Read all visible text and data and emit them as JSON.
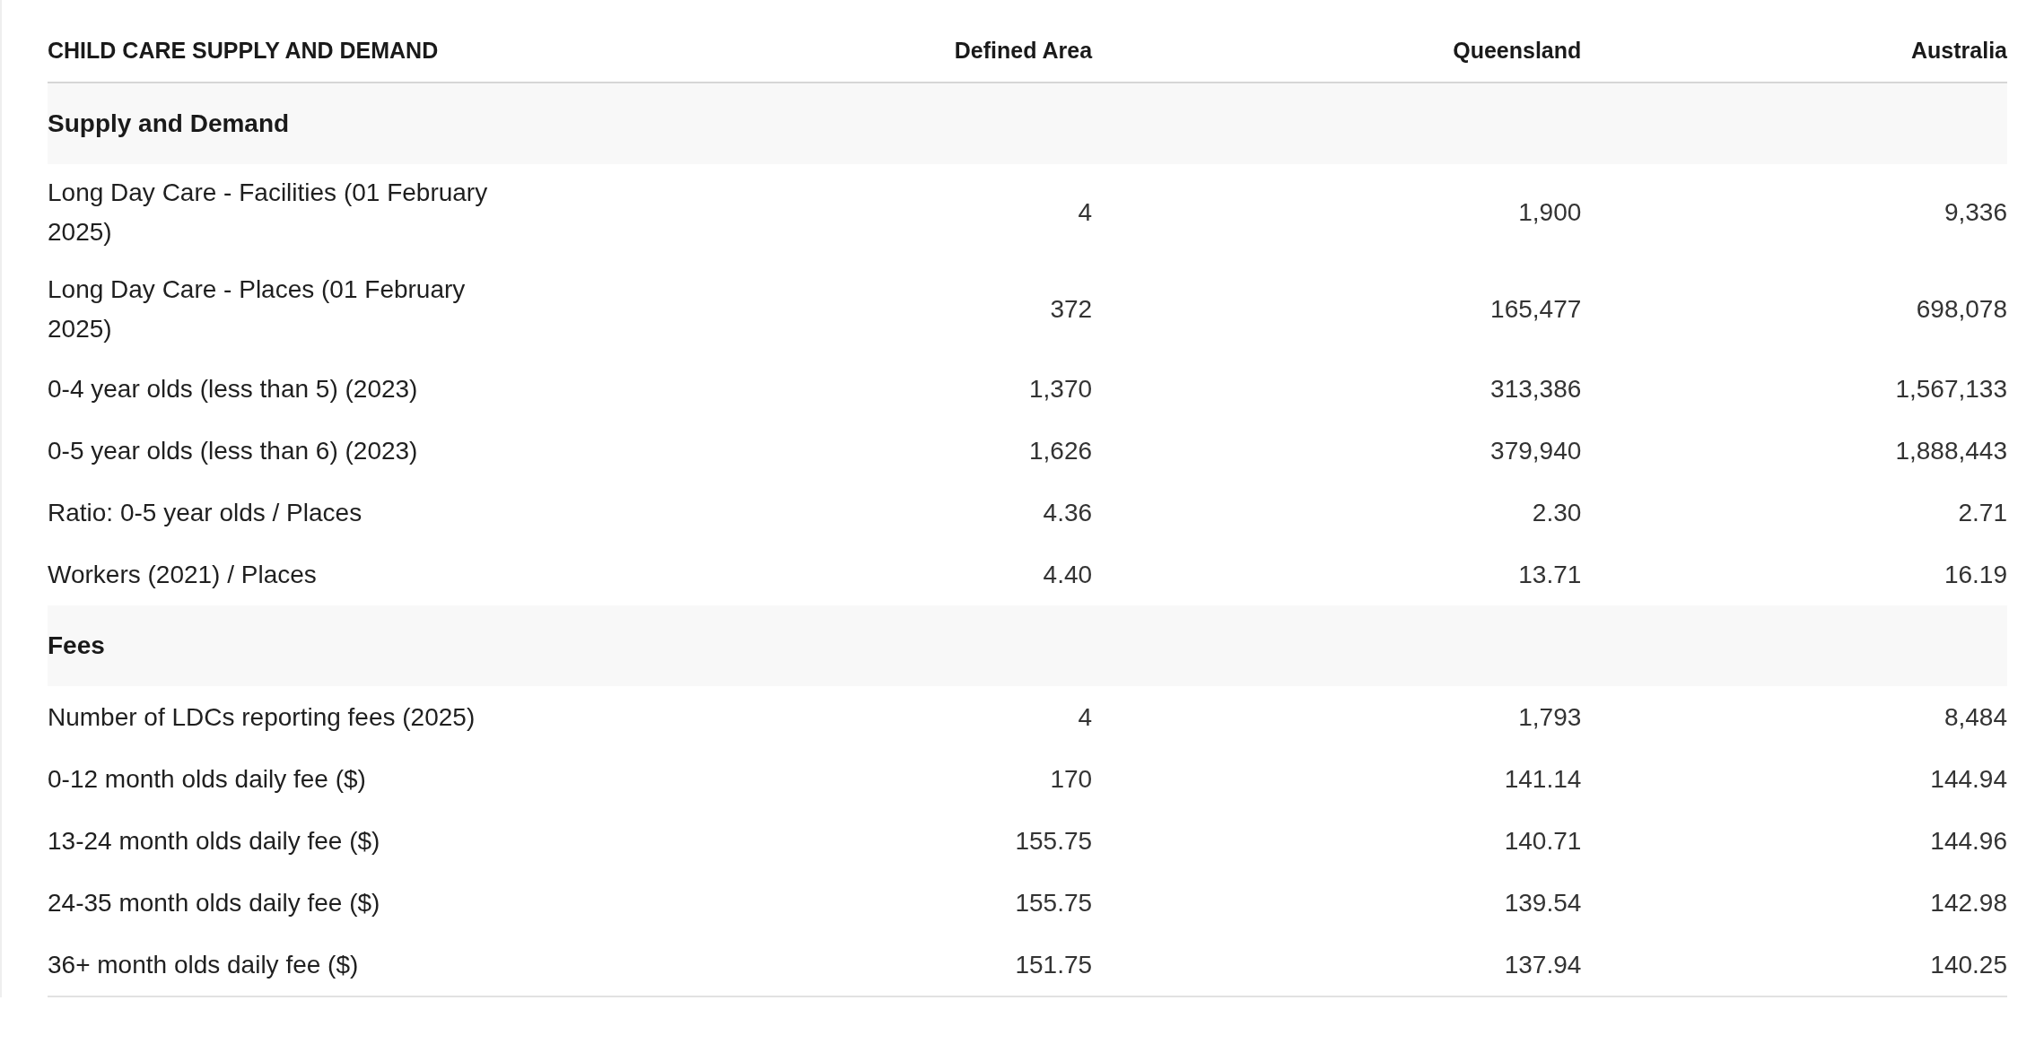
{
  "table": {
    "columns": [
      "CHILD CARE SUPPLY AND DEMAND",
      "Defined Area",
      "Queensland",
      "Australia"
    ],
    "sections": [
      {
        "title": "Supply and Demand",
        "rows": [
          {
            "label": "Long Day Care - Facilities (01 February 2025)",
            "values": [
              "4",
              "1,900",
              "9,336"
            ]
          },
          {
            "label": "Long Day Care - Places (01 February 2025)",
            "values": [
              "372",
              "165,477",
              "698,078"
            ]
          },
          {
            "label": "0-4 year olds (less than 5) (2023)",
            "values": [
              "1,370",
              "313,386",
              "1,567,133"
            ]
          },
          {
            "label": "0-5 year olds (less than 6) (2023)",
            "values": [
              "1,626",
              "379,940",
              "1,888,443"
            ]
          },
          {
            "label": "Ratio: 0-5 year olds / Places",
            "values": [
              "4.36",
              "2.30",
              "2.71"
            ]
          },
          {
            "label": "Workers (2021) / Places",
            "values": [
              "4.40",
              "13.71",
              "16.19"
            ]
          }
        ]
      },
      {
        "title": "Fees",
        "rows": [
          {
            "label": "Number of LDCs reporting fees (2025)",
            "values": [
              "4",
              "1,793",
              "8,484"
            ]
          },
          {
            "label": "0-12 month olds daily fee ($)",
            "values": [
              "170",
              "141.14",
              "144.94"
            ]
          },
          {
            "label": "13-24 month olds daily fee ($)",
            "values": [
              "155.75",
              "140.71",
              "144.96"
            ]
          },
          {
            "label": "24-35 month olds daily fee ($)",
            "values": [
              "155.75",
              "139.54",
              "142.98"
            ]
          },
          {
            "label": "36+ month olds daily fee ($)",
            "values": [
              "151.75",
              "137.94",
              "140.25"
            ]
          }
        ]
      }
    ]
  }
}
